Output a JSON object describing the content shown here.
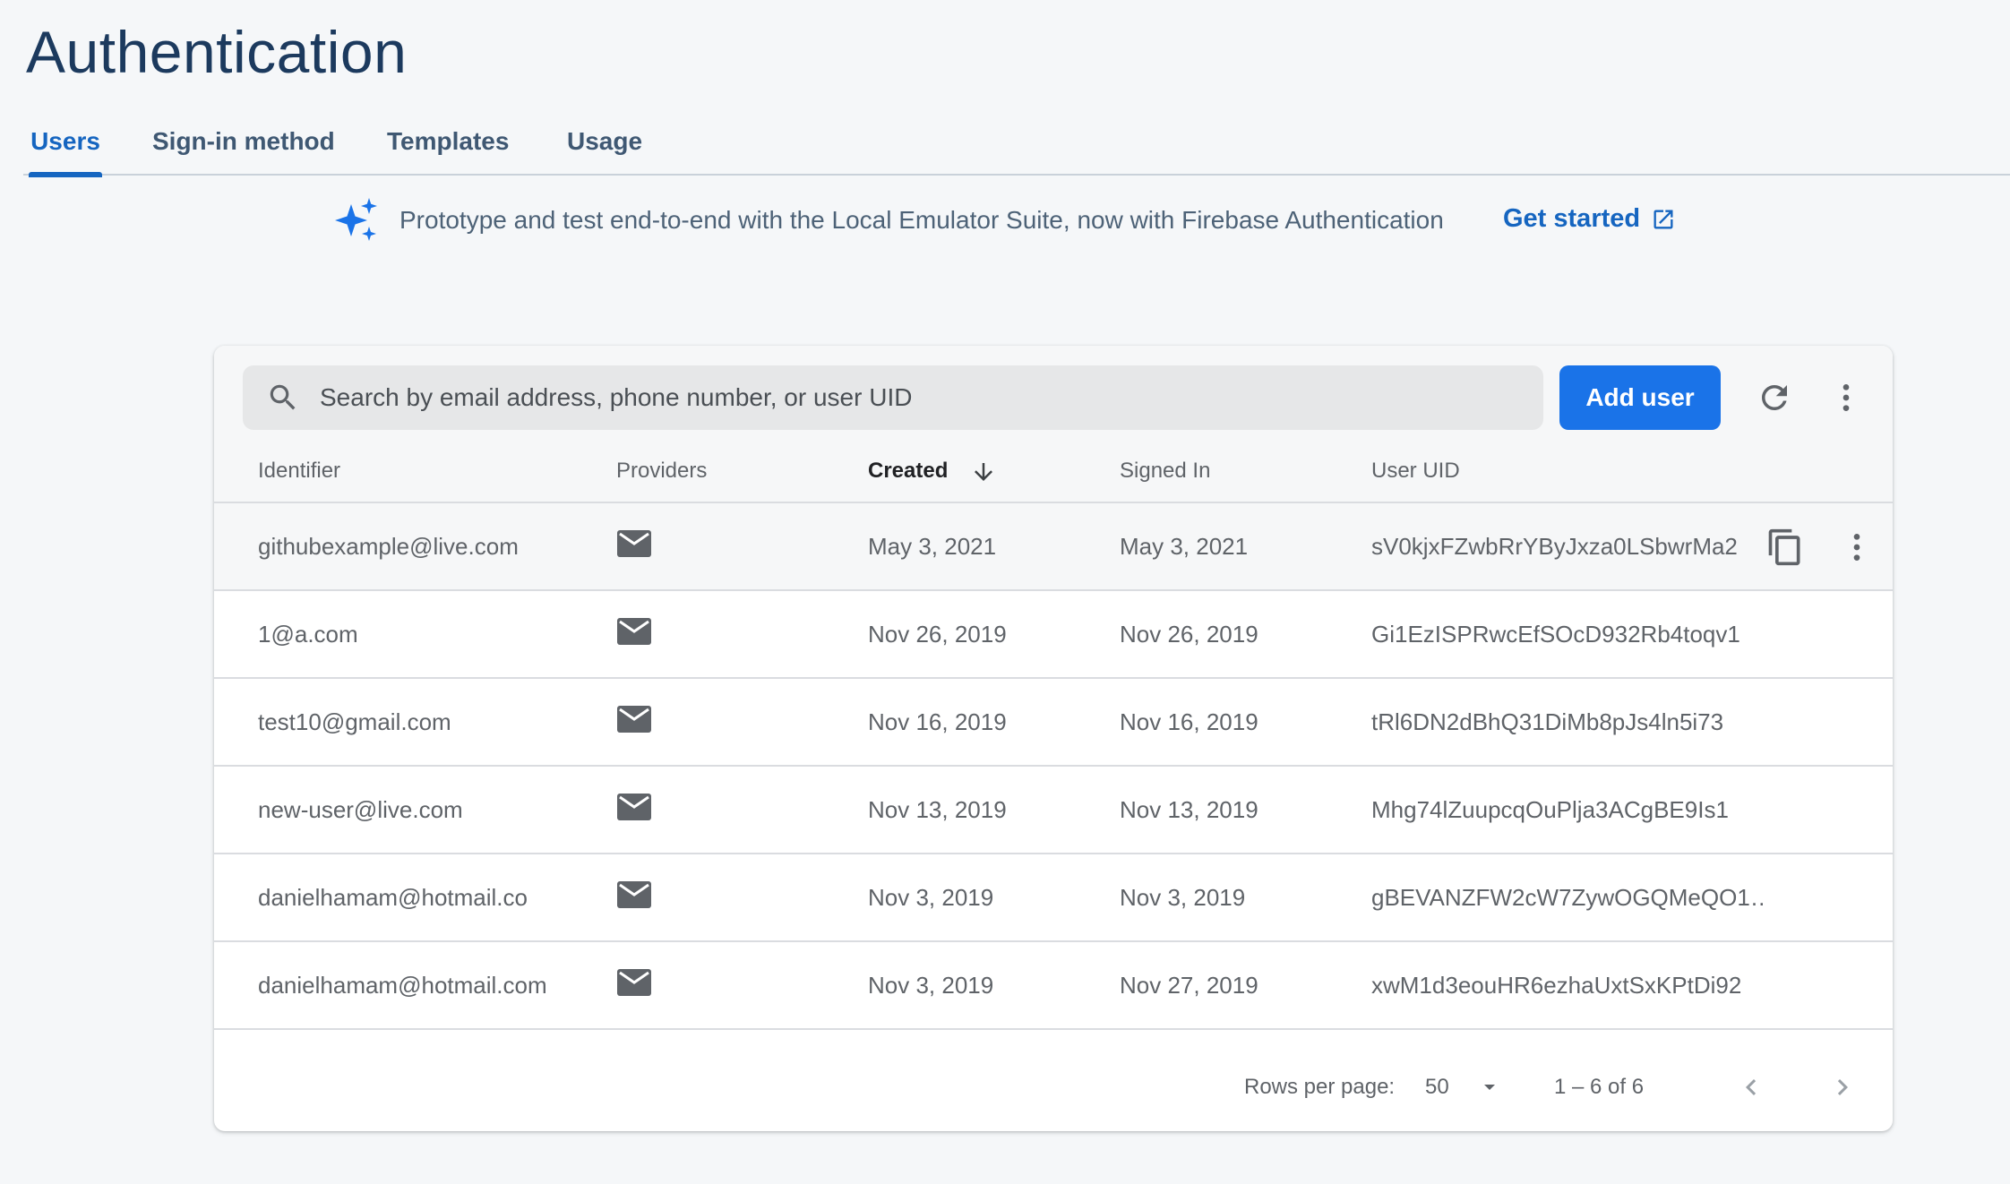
{
  "page": {
    "title": "Authentication"
  },
  "tabs": [
    {
      "label": "Users",
      "active": true
    },
    {
      "label": "Sign-in method",
      "active": false
    },
    {
      "label": "Templates",
      "active": false
    },
    {
      "label": "Usage",
      "active": false
    }
  ],
  "banner": {
    "icon": "sparkle-icon",
    "text": "Prototype and test end-to-end with the Local Emulator Suite, now with Firebase Authentication",
    "link_label": "Get started",
    "link_icon": "open-in-new-icon"
  },
  "toolbar": {
    "search_placeholder": "Search by email address, phone number, or user UID",
    "add_user_label": "Add user",
    "refresh_icon": "refresh-icon",
    "more_icon": "more-vert-icon"
  },
  "table": {
    "columns": [
      "Identifier",
      "Providers",
      "Created",
      "Signed In",
      "User UID"
    ],
    "sorted_column": "Created",
    "sort_direction": "descending",
    "rows": [
      {
        "identifier": "githubexample@live.com",
        "provider": "email-icon",
        "created": "May 3, 2021",
        "signed_in": "May 3, 2021",
        "uid": "sV0kjxFZwbRrYByJxza0LSbwrMa2",
        "hovered": true
      },
      {
        "identifier": "1@a.com",
        "provider": "email-icon",
        "created": "Nov 26, 2019",
        "signed_in": "Nov 26, 2019",
        "uid": "Gi1EzISPRwcEfSOcD932Rb4toqv1"
      },
      {
        "identifier": "test10@gmail.com",
        "provider": "email-icon",
        "created": "Nov 16, 2019",
        "signed_in": "Nov 16, 2019",
        "uid": "tRl6DN2dBhQ31DiMb8pJs4ln5i73"
      },
      {
        "identifier": "new-user@live.com",
        "provider": "email-icon",
        "created": "Nov 13, 2019",
        "signed_in": "Nov 13, 2019",
        "uid": "Mhg74lZuupcqOuPlja3ACgBE9Is1"
      },
      {
        "identifier": "danielhamam@hotmail.co",
        "provider": "email-icon",
        "created": "Nov 3, 2019",
        "signed_in": "Nov 3, 2019",
        "uid": "gBEVANZFW2cW7ZywOGQMeQO1…"
      },
      {
        "identifier": "danielhamam@hotmail.com",
        "provider": "email-icon",
        "created": "Nov 3, 2019",
        "signed_in": "Nov 27, 2019",
        "uid": "xwM1d3eouHR6ezhaUxtSxKPtDi92"
      }
    ]
  },
  "pagination": {
    "rows_per_page_label": "Rows per page:",
    "rows_per_page_value": "50",
    "range_label": "1 – 6 of 6"
  },
  "colors": {
    "accent": "#1565c0",
    "button": "#1a73e8",
    "title": "#1c3a5e"
  }
}
